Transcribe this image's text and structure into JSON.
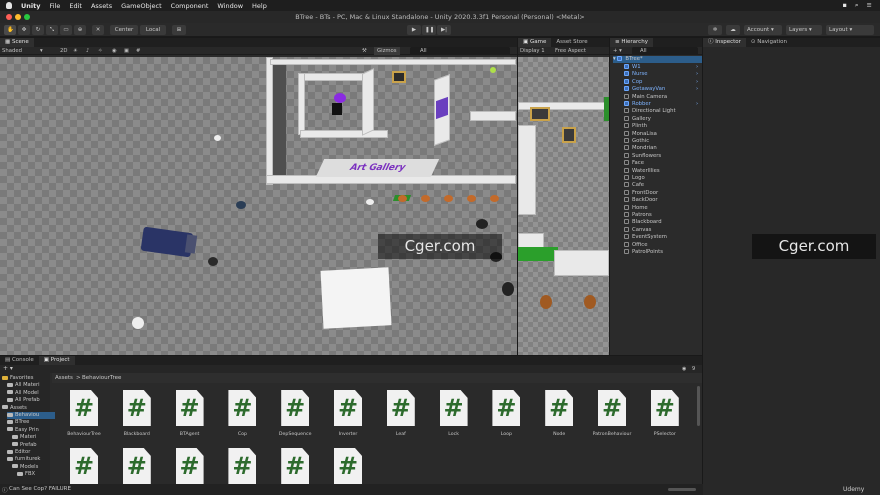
{
  "mac_menu": {
    "apple": "",
    "app": "Unity",
    "items": [
      "File",
      "Edit",
      "Assets",
      "GameObject",
      "Component",
      "Window",
      "Help"
    ]
  },
  "window_title": "BTree - BTs - PC, Mac & Linux Standalone - Unity 2020.3.3f1 Personal (Personal) <Metal>",
  "toolbar": {
    "center": "Center",
    "local": "Local",
    "account": "Account",
    "layers": "Layers",
    "layout": "Layout"
  },
  "scene": {
    "tab_scene": "Scene",
    "tab_game": "Game",
    "tab_asset_store": "Asset Store",
    "shading": "Shaded",
    "mode2d": "2D",
    "gizmos": "Gizmos",
    "search_all": "All",
    "display": "Display 1",
    "aspect": "Free Aspect",
    "banner": "Art Gallery"
  },
  "hierarchy": {
    "title": "Hierarchy",
    "search": "All",
    "root": "BTree*",
    "items": [
      {
        "label": "W1",
        "prefab": true
      },
      {
        "label": "Nurse",
        "prefab": true
      },
      {
        "label": "Cop",
        "prefab": true
      },
      {
        "label": "GetawayVan",
        "prefab": true
      },
      {
        "label": "Main Camera",
        "prefab": false
      },
      {
        "label": "Robber",
        "prefab": true
      },
      {
        "label": "Directional Light",
        "prefab": false
      },
      {
        "label": "Gallery",
        "prefab": false
      },
      {
        "label": "Plinth",
        "prefab": false
      },
      {
        "label": "MonaLisa",
        "prefab": false
      },
      {
        "label": "Gothic",
        "prefab": false
      },
      {
        "label": "Mondrian",
        "prefab": false
      },
      {
        "label": "Sunflowers",
        "prefab": false
      },
      {
        "label": "Face",
        "prefab": false
      },
      {
        "label": "WaterlIlies",
        "prefab": false
      },
      {
        "label": "Logo",
        "prefab": false
      },
      {
        "label": "Cafe",
        "prefab": false
      },
      {
        "label": "FrontDoor",
        "prefab": false
      },
      {
        "label": "BackDoor",
        "prefab": false
      },
      {
        "label": "Home",
        "prefab": false
      },
      {
        "label": "Patrons",
        "prefab": false
      },
      {
        "label": "Blackboard",
        "prefab": false
      },
      {
        "label": "Canvas",
        "prefab": false
      },
      {
        "label": "EventSystem",
        "prefab": false
      },
      {
        "label": "Office",
        "prefab": false
      },
      {
        "label": "PatrolPoints",
        "prefab": false
      }
    ]
  },
  "inspector": {
    "tab_inspector": "Inspector",
    "tab_navigation": "Navigation"
  },
  "bottom": {
    "tab_console": "Console",
    "tab_project": "Project",
    "breadcrumb_root": "Assets",
    "breadcrumb_sep": ">",
    "breadcrumb_folder": "BehaviourTree",
    "badge": "9",
    "tree": [
      {
        "label": "Favorites",
        "indent": 0
      },
      {
        "label": "All Materi",
        "indent": 1
      },
      {
        "label": "All Model",
        "indent": 1
      },
      {
        "label": "All Prefab",
        "indent": 1
      },
      {
        "label": "Assets",
        "indent": 0
      },
      {
        "label": "Behaviou",
        "indent": 1
      },
      {
        "label": "BTree",
        "indent": 1
      },
      {
        "label": "Easy Prin",
        "indent": 1
      },
      {
        "label": "Materi",
        "indent": 2
      },
      {
        "label": "Prefab",
        "indent": 2
      },
      {
        "label": "Editor",
        "indent": 1
      },
      {
        "label": "furniturek",
        "indent": 1
      },
      {
        "label": "Models",
        "indent": 2
      },
      {
        "label": "FBX",
        "indent": 3
      }
    ],
    "scripts": [
      "BehaviourTree",
      "Blackboard",
      "BTAgent",
      "Cop",
      "DepSequence",
      "Inverter",
      "Leaf",
      "Lock",
      "Loop",
      "Node",
      "PatronBehaviour",
      "PSelector",
      "",
      "",
      "",
      "",
      "",
      ""
    ],
    "script_glyph": "#"
  },
  "status": {
    "message": "Can See Cop? FAILURE",
    "udemy": "Udemy"
  },
  "watermark": "Cger.com"
}
